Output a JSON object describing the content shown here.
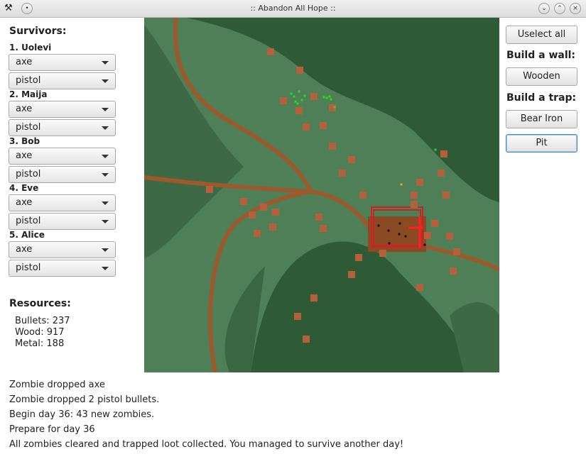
{
  "window": {
    "title": ":: Abandon All Hope ::"
  },
  "survivors": {
    "heading": "Survivors:",
    "list": [
      {
        "name": "1. Uolevi",
        "weapon": "axe",
        "gun": "pistol"
      },
      {
        "name": "2. Maija",
        "weapon": "axe",
        "gun": "pistol"
      },
      {
        "name": "3. Bob",
        "weapon": "axe",
        "gun": "pistol"
      },
      {
        "name": "4. Eve",
        "weapon": "axe",
        "gun": "pistol"
      },
      {
        "name": "5. Alice",
        "weapon": "axe",
        "gun": "pistol"
      }
    ]
  },
  "resources": {
    "heading": "Resources:",
    "bullets": "Bullets: 237",
    "wood": "Wood: 917",
    "metal": "Metal: 188"
  },
  "controls": {
    "unselect_all": "Uselect all",
    "build_wall_heading": "Build a wall:",
    "wooden": "Wooden",
    "build_trap_heading": "Build a trap:",
    "bear_iron": "Bear Iron",
    "pit": "Pit"
  },
  "log": [
    "Zombie dropped axe",
    "Zombie dropped 2 pistol bullets.",
    "Begin day 36: 43 new zombies.",
    "Prepare for day 36",
    "All zombies cleared and trapped loot collected. You managed to survive another day!"
  ],
  "colors": {
    "terrain_light": "#4f7f57",
    "terrain_dark": "#2e5a36",
    "road": "#9a5a2c",
    "zombie": "#b5603c",
    "survivor": "#22dd22",
    "wall": "#cc2222"
  }
}
